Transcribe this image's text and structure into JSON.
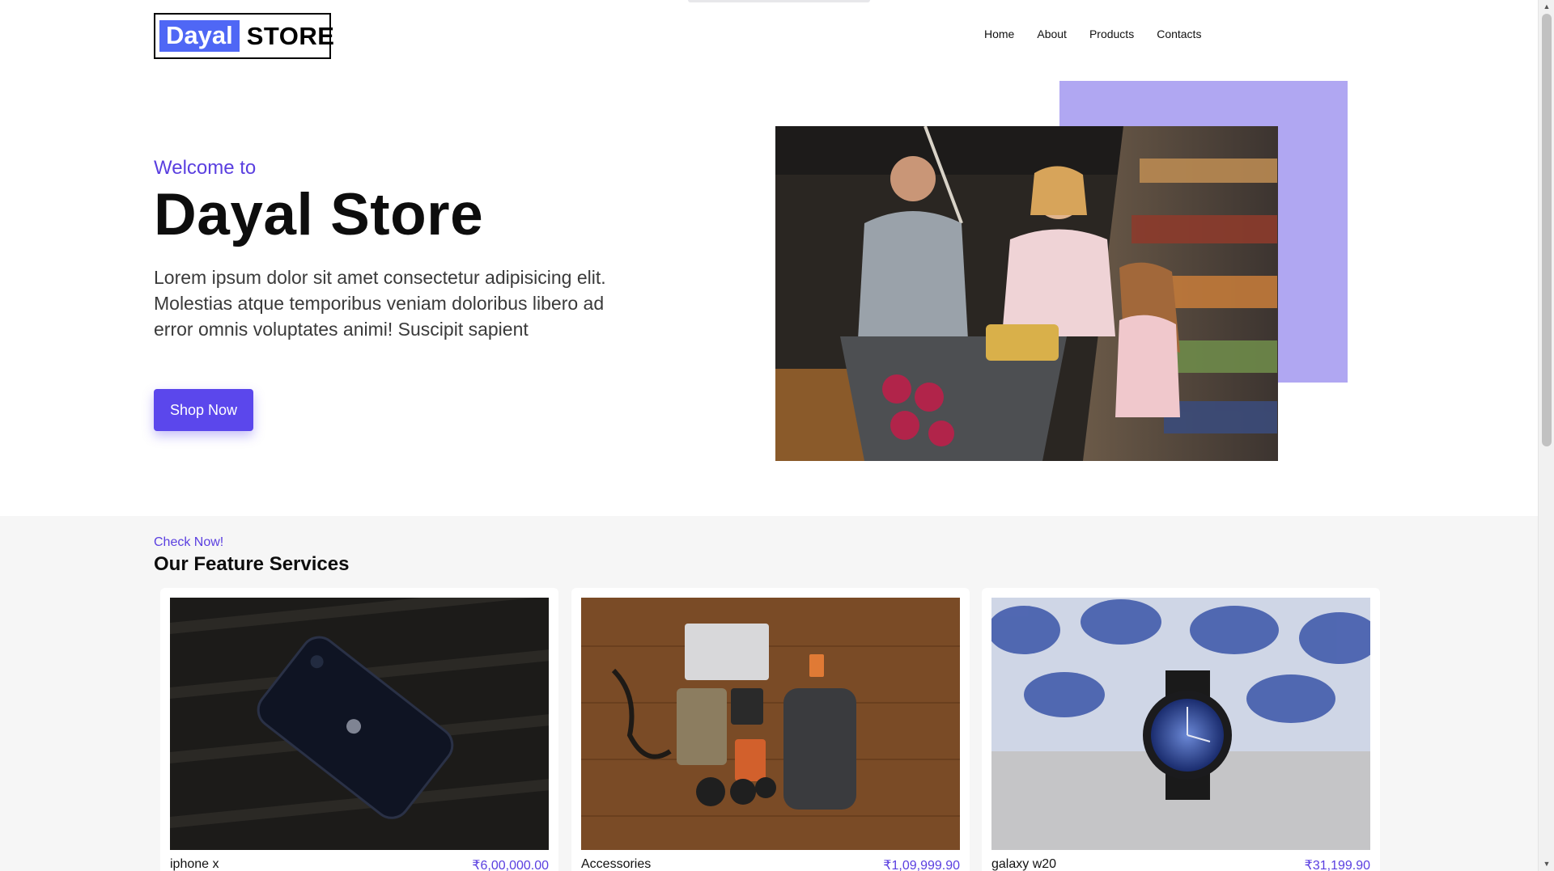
{
  "header": {
    "logo": {
      "brand": "Dayal",
      "suffix": "STORE"
    },
    "nav": [
      {
        "label": "Home"
      },
      {
        "label": "About"
      },
      {
        "label": "Products"
      },
      {
        "label": "Contacts"
      }
    ]
  },
  "hero": {
    "welcome": "Welcome to",
    "title": "Dayal Store",
    "text": "Lorem ipsum dolor sit amet consectetur adipisicing elit. Molestias atque temporibus veniam doloribus libero ad error omnis voluptates animi! Suscipit sapient",
    "button": "Shop Now"
  },
  "services": {
    "eyebrow": "Check Now!",
    "title": "Our Feature Services",
    "cards": [
      {
        "name": "iphone x",
        "price": "₹6,00,000.00"
      },
      {
        "name": "Accessories",
        "price": "₹1,09,999.90"
      },
      {
        "name": "galaxy w20",
        "price": "₹31,199.90"
      }
    ]
  },
  "colors": {
    "accent": "#5b47ec",
    "logo_blue": "#4f67f5",
    "hero_accent_block": "#b0a7f2"
  }
}
